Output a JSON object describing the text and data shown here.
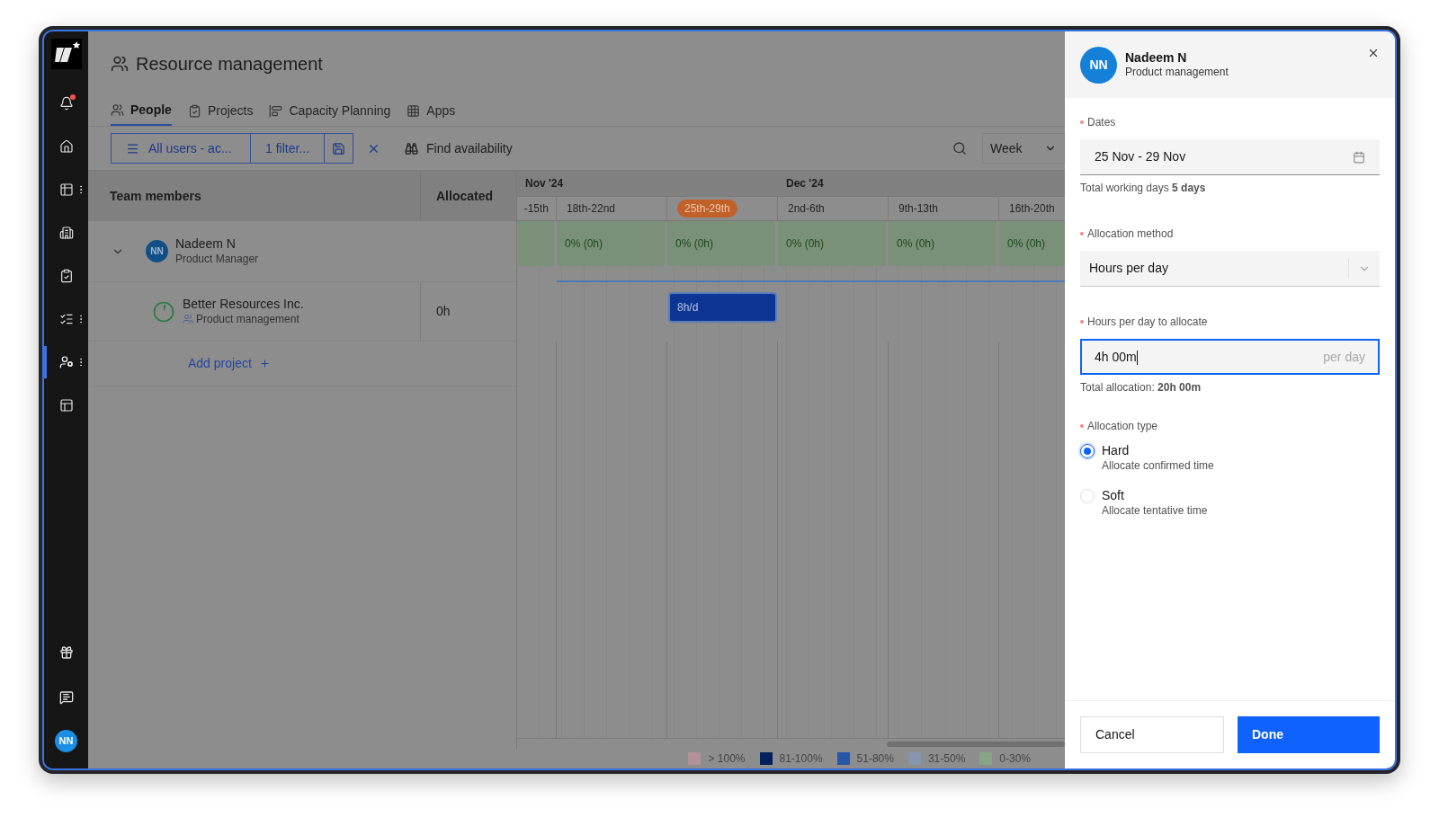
{
  "sidebar": {
    "items": [
      {
        "selected": false,
        "has_menu": false,
        "notification": true
      },
      {
        "selected": false,
        "has_menu": false,
        "notification": false
      },
      {
        "selected": false,
        "has_menu": true,
        "notification": false
      },
      {
        "selected": false,
        "has_menu": false,
        "notification": false
      },
      {
        "selected": false,
        "has_menu": false,
        "notification": false
      },
      {
        "selected": false,
        "has_menu": true,
        "notification": false
      },
      {
        "selected": true,
        "has_menu": true,
        "notification": false
      },
      {
        "selected": false,
        "has_menu": false,
        "notification": false
      }
    ],
    "avatar": "NN"
  },
  "page": {
    "title": "Resource management",
    "tabs": [
      {
        "label": "People",
        "selected": true
      },
      {
        "label": "Projects",
        "selected": false
      },
      {
        "label": "Capacity Planning",
        "selected": false
      },
      {
        "label": "Apps",
        "selected": false
      }
    ],
    "toolbar": {
      "view": "All users - ac...",
      "filter": "1 filter...",
      "find": "Find availability",
      "period": "Week"
    },
    "table": {
      "columns": [
        "Team members",
        "Allocated"
      ],
      "months": [
        {
          "label": "Nov '24",
          "weeks": [
            {
              "label": "-15th",
              "current": false
            },
            {
              "label": "18th-22nd",
              "current": false
            },
            {
              "label": "25th-29th",
              "current": true
            }
          ]
        },
        {
          "label": "Dec '24",
          "weeks": [
            {
              "label": "2nd-6th",
              "current": false
            },
            {
              "label": "9th-13th",
              "current": false
            },
            {
              "label": "16th-20th",
              "current": false
            }
          ]
        }
      ],
      "members": [
        {
          "initials": "NN",
          "name": "Nadeem N",
          "role": "Product Manager",
          "expanded": true,
          "loads": [
            "0% (0h)",
            "0% (0h)",
            "0% (0h)",
            "0% (0h)",
            "0% (0h)"
          ],
          "projects": [
            {
              "name": "Better Resources Inc.",
              "department": "Product management",
              "allocated": "0h",
              "booking": "8h/d"
            }
          ]
        }
      ],
      "add_project": "Add project"
    },
    "legend": [
      {
        "label": "> 100%",
        "color": "#b39199"
      },
      {
        "label": "81-100%",
        "color": "#06205c"
      },
      {
        "label": "51-80%",
        "color": "#2856a6"
      },
      {
        "label": "31-50%",
        "color": "#8696ae"
      },
      {
        "label": "0-30%",
        "color": "#87a487"
      }
    ]
  },
  "panel": {
    "initials": "NN",
    "name": "Nadeem N",
    "subtitle": "Product management",
    "dates": {
      "label": "Dates",
      "required": true,
      "value": "25 Nov - 29 Nov",
      "hint": "Total working days **5 days**"
    },
    "method": {
      "label": "Allocation method",
      "required": true,
      "value": "Hours per day"
    },
    "hours": {
      "label": "Hours per day to allocate",
      "required": true,
      "value": "4h 00m",
      "suffix": "per day",
      "focused": true,
      "hint": "Total allocation: **20h 00m**"
    },
    "type": {
      "label": "Allocation type",
      "required": true,
      "options": [
        {
          "label": "Hard",
          "description": "Allocate confirmed time",
          "selected": true
        },
        {
          "label": "Soft",
          "description": "Allocate tentative time",
          "selected": false
        }
      ]
    },
    "buttons": [
      {
        "label": "Cancel",
        "kind": "secondary"
      },
      {
        "label": "Done",
        "kind": "primary"
      }
    ]
  }
}
